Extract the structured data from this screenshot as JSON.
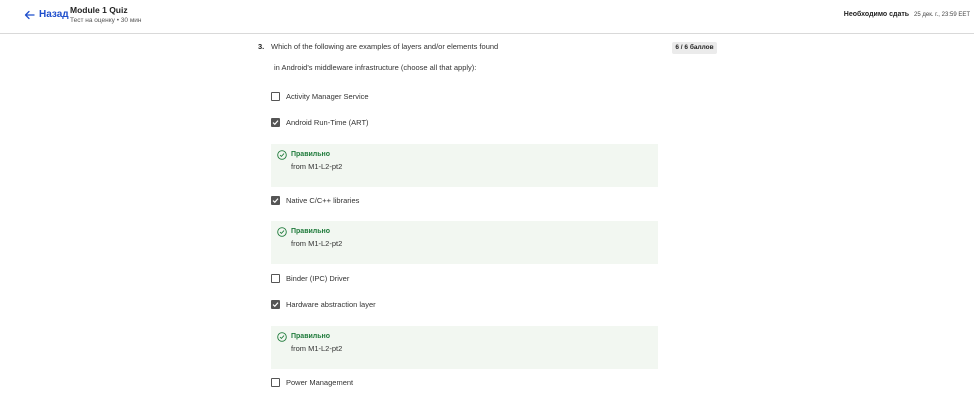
{
  "header": {
    "back_label": "Назад",
    "quiz_title": "Module 1 Quiz",
    "quiz_subtitle": "Тест на оценку • 30 мин",
    "due_label": "Необходимо сдать",
    "due_date": "25 дек. г., 23:59 EET"
  },
  "question": {
    "number": "3.",
    "text_line1": "Which of the following are examples of layers and/or elements found",
    "text_line2": "in Android's middleware infrastructure (choose all that apply):",
    "score": "6 / 6 баллов",
    "options": [
      {
        "label": "Activity Manager Service",
        "checked": false
      },
      {
        "label": "Android Run-Time (ART)",
        "checked": true
      },
      {
        "label": "Native C/C++ libraries",
        "checked": true
      },
      {
        "label": "Binder (IPC) Driver",
        "checked": false
      },
      {
        "label": "Hardware abstraction layer",
        "checked": true
      },
      {
        "label": "Power Management",
        "checked": false
      }
    ],
    "feedback": [
      {
        "title": "Правильно",
        "text": "from M1-L2-pt2"
      },
      {
        "title": "Правильно",
        "text": "from M1-L2-pt2"
      },
      {
        "title": "Правильно",
        "text": "from M1-L2-pt2"
      }
    ]
  },
  "colors": {
    "link": "#1f4fcc",
    "correct": "#1e7a3a",
    "feedback_bg": "#f2f7f1"
  }
}
